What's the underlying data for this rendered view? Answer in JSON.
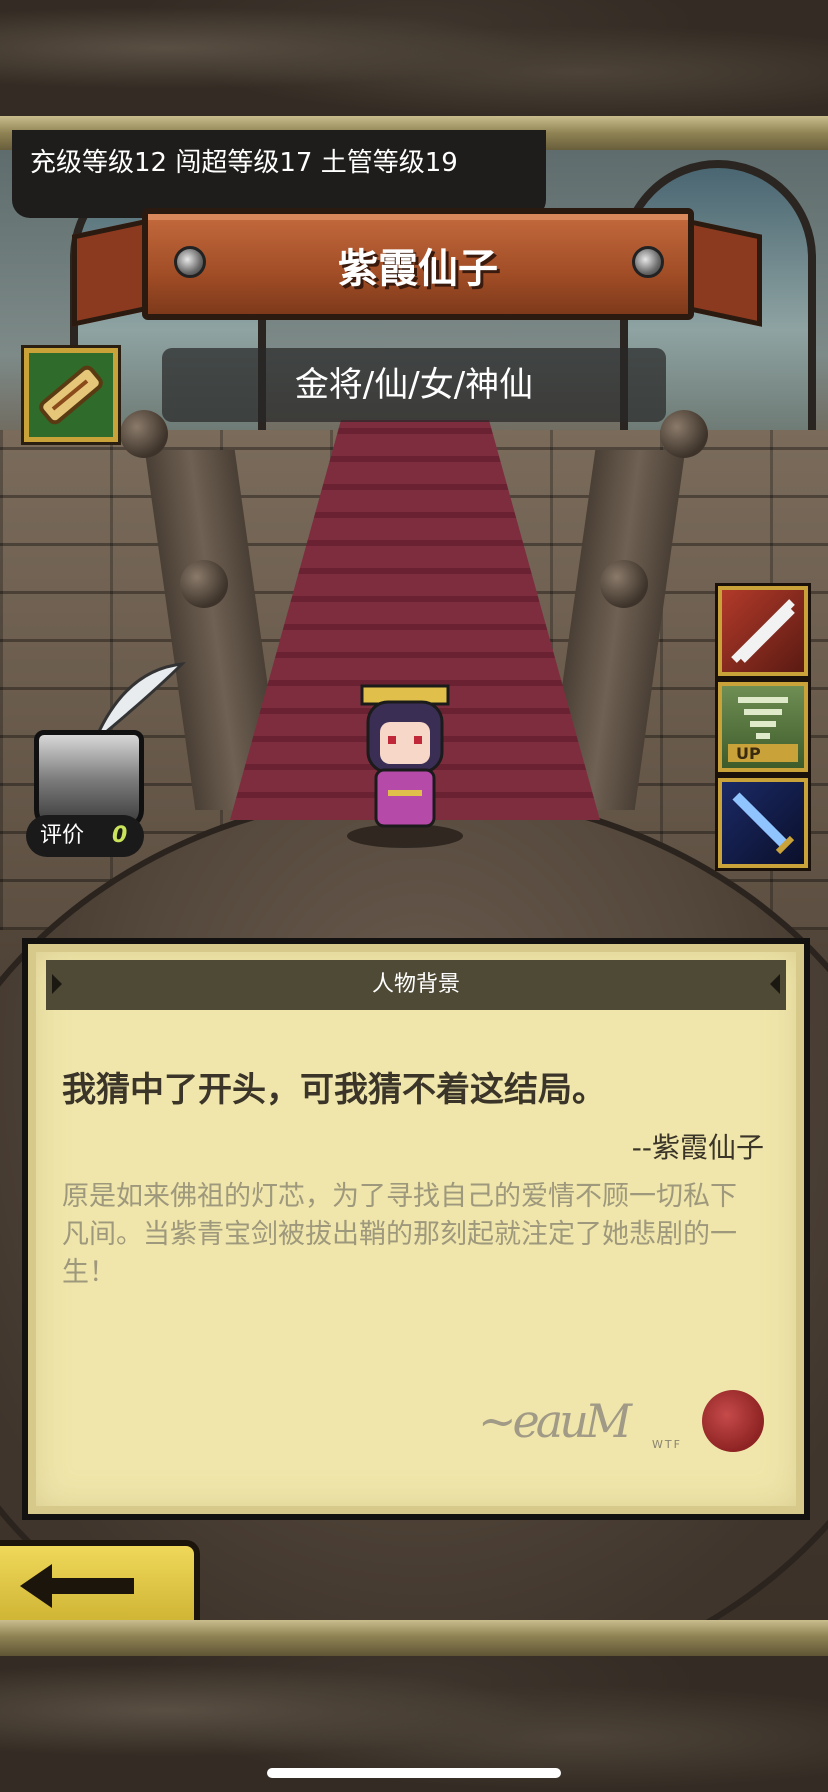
{
  "info_bar": {
    "text": "充级等级12 闯超等级17 土管等级19"
  },
  "hero": {
    "name": "紫霞仙子",
    "classes": "金将/仙/女/神仙"
  },
  "rating": {
    "label": "评价",
    "value": "0"
  },
  "skills": [
    "sword-slash-icon",
    "tornado-up-icon",
    "blue-sword-icon"
  ],
  "background": {
    "header": "人物背景",
    "quote": "我猜中了开头，可我猜不着这结局。",
    "attribution": "--紫霞仙子",
    "bio": "原是如来佛祖的灯芯，为了寻找自己的爱情不顾一切私下凡间。当紫青宝剑被拔出鞘的那刻起就注定了她悲剧的一生！",
    "signature_mark": "WTF"
  },
  "colors": {
    "banner": "#a14d26",
    "parchment": "#f0e6ab",
    "back_button": "#e3c94a"
  }
}
